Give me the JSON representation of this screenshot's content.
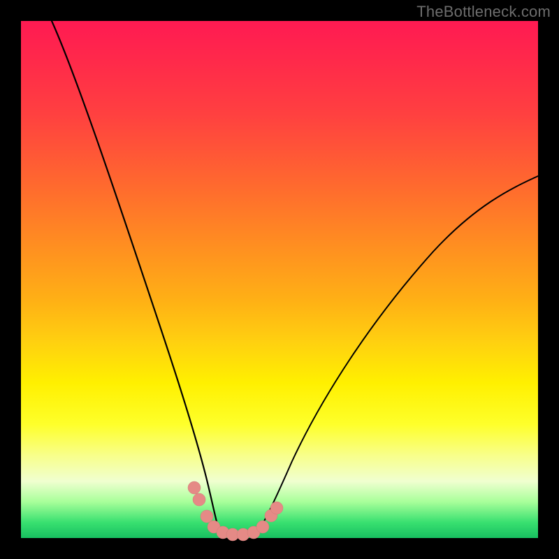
{
  "watermark": "TheBottleneck.com",
  "chart_data": {
    "type": "line",
    "title": "",
    "xlabel": "",
    "ylabel": "",
    "xlim": [
      0,
      100
    ],
    "ylim": [
      0,
      100
    ],
    "grid": false,
    "legend": false,
    "gradient_meaning": "top=red (high bottleneck), bottom=green (no bottleneck)",
    "series": [
      {
        "name": "left-branch",
        "x": [
          6,
          10,
          14,
          18,
          22,
          26,
          28,
          30,
          32,
          33.5,
          35,
          36.5,
          38
        ],
        "y": [
          100,
          86,
          73,
          60,
          47,
          33,
          26,
          19,
          12,
          8.5,
          5,
          2.5,
          1
        ]
      },
      {
        "name": "bottom-flat",
        "x": [
          38,
          40,
          42,
          44,
          46
        ],
        "y": [
          1,
          0.6,
          0.5,
          0.6,
          1
        ]
      },
      {
        "name": "right-branch",
        "x": [
          46,
          48,
          50,
          54,
          58,
          64,
          70,
          78,
          86,
          94,
          100
        ],
        "y": [
          1,
          3,
          5.5,
          12,
          19,
          28,
          37,
          47,
          56,
          64,
          70
        ]
      }
    ],
    "markers": [
      {
        "x": 33.3,
        "y": 9.5
      },
      {
        "x": 34.2,
        "y": 7.2
      },
      {
        "x": 35.8,
        "y": 3.8
      },
      {
        "x": 37.2,
        "y": 1.8
      },
      {
        "x": 39.0,
        "y": 0.9
      },
      {
        "x": 41.0,
        "y": 0.6
      },
      {
        "x": 43.0,
        "y": 0.6
      },
      {
        "x": 45.0,
        "y": 0.9
      },
      {
        "x": 46.8,
        "y": 1.8
      },
      {
        "x": 48.4,
        "y": 4.0
      },
      {
        "x": 49.2,
        "y": 5.3
      }
    ]
  }
}
